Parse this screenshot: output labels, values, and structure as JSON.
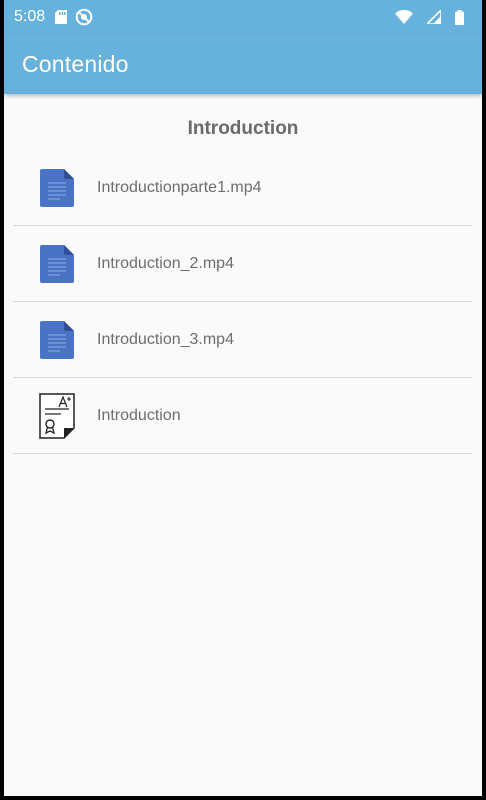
{
  "status_bar": {
    "time": "5:08",
    "icons": [
      "sd-card-icon",
      "no-data-icon",
      "wifi-icon",
      "signal-icon",
      "battery-icon"
    ]
  },
  "app_bar": {
    "title": "Contenido"
  },
  "section": {
    "title": "Introduction"
  },
  "items": [
    {
      "label": "Introductionparte1.mp4",
      "icon": "document-icon"
    },
    {
      "label": "Introduction_2.mp4",
      "icon": "document-icon"
    },
    {
      "label": "Introduction_3.mp4",
      "icon": "document-icon"
    },
    {
      "label": "Introduction",
      "icon": "certificate-icon"
    }
  ],
  "colors": {
    "primary": "#66b2dc",
    "background": "#fafafa",
    "divider": "#d8d8d8",
    "text": "#6e6e6e",
    "doc_icon": "#4a73c4"
  }
}
